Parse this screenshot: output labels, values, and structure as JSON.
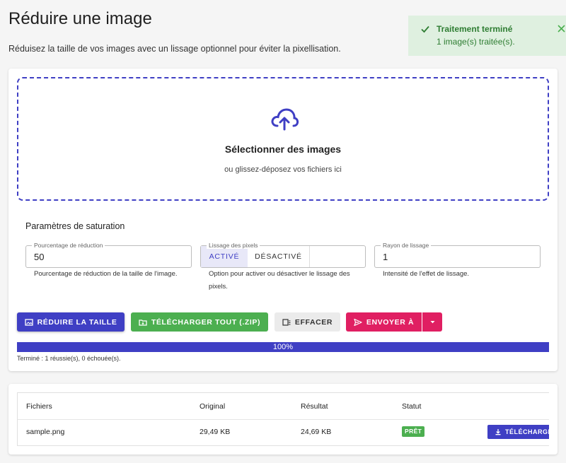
{
  "page": {
    "title": "Réduire une image",
    "description": "Réduisez la taille de vos images avec un lissage optionnel pour éviter la pixellisation."
  },
  "toast": {
    "title": "Traitement terminé",
    "message": "1 image(s) traitée(s).",
    "color": "#2e7d32",
    "background": "#dff0e0"
  },
  "dropzone": {
    "title": "Sélectionner des images",
    "subtitle": "ou glissez-déposez vos fichiers ici",
    "icon": "cloud-upload-icon"
  },
  "settings": {
    "title": "Paramètres de saturation",
    "reduction": {
      "label": "Pourcentage de réduction",
      "value": "50",
      "helper": "Pourcentage de réduction de la taille de l'image."
    },
    "smoothing": {
      "label": "Lissage des pixels",
      "options": [
        "ACTIVÉ",
        "DÉSACTIVÉ"
      ],
      "selected": "ACTIVÉ",
      "helper": "Option pour activer ou désactiver le lissage des pixels."
    },
    "radius": {
      "label": "Rayon de lissage",
      "value": "1",
      "helper": "Intensité de l'effet de lissage."
    }
  },
  "actions": {
    "reduce": "RÉDUIRE LA TAILLE",
    "download_all": "TÉLÉCHARGER TOUT (.ZIP)",
    "clear": "EFFACER",
    "send_to": "ENVOYER À"
  },
  "progress": {
    "percent": 100,
    "label": "100%",
    "status": "Terminé : 1 réussie(s), 0 échouée(s)."
  },
  "table": {
    "headers": [
      "Fichiers",
      "Original",
      "Résultat",
      "Statut"
    ],
    "rows": [
      {
        "file": "sample.png",
        "original": "29,49 KB",
        "result": "24,69 KB",
        "status": "PRÊT",
        "action": "TÉLÉCHARGER"
      }
    ]
  },
  "colors": {
    "primary": "#3f3fc4",
    "success": "#4caf50",
    "accent": "#e01f62"
  }
}
